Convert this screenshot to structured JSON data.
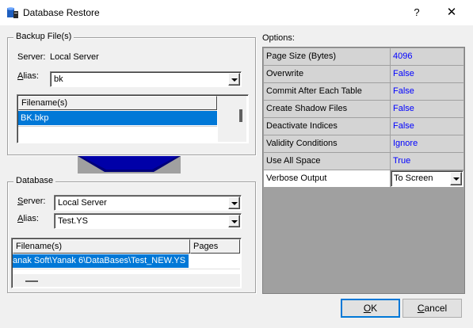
{
  "window": {
    "title": "Database Restore",
    "help": "?",
    "close": "✕"
  },
  "backup": {
    "legend": "Backup File(s)",
    "server_label": "Server:",
    "server_value": "Local Server",
    "alias_label": "Alias:",
    "alias_value": "bk",
    "files_header": "Filename(s)",
    "files": [
      "BK.bkp"
    ]
  },
  "database": {
    "legend": "Database",
    "server_label": "Server:",
    "server_value": "Local Server",
    "alias_label": "Alias:",
    "alias_value": "Test.YS",
    "col_filename": "Filename(s)",
    "col_pages": "Pages",
    "files": [
      {
        "filename": "anak Soft\\Yanak 6\\DataBases\\Test_NEW.YS",
        "pages": ""
      }
    ]
  },
  "options": {
    "label": "Options:",
    "rows": [
      {
        "name": "Page Size (Bytes)",
        "value": "4096"
      },
      {
        "name": "Overwrite",
        "value": "False"
      },
      {
        "name": "Commit After Each Table",
        "value": "False"
      },
      {
        "name": "Create Shadow Files",
        "value": "False"
      },
      {
        "name": "Deactivate Indices",
        "value": "False"
      },
      {
        "name": "Validity Conditions",
        "value": "Ignore"
      },
      {
        "name": "Use All Space",
        "value": "True"
      },
      {
        "name": "Verbose Output",
        "value": "To Screen"
      }
    ]
  },
  "buttons": {
    "ok": "OK",
    "cancel": "Cancel"
  }
}
